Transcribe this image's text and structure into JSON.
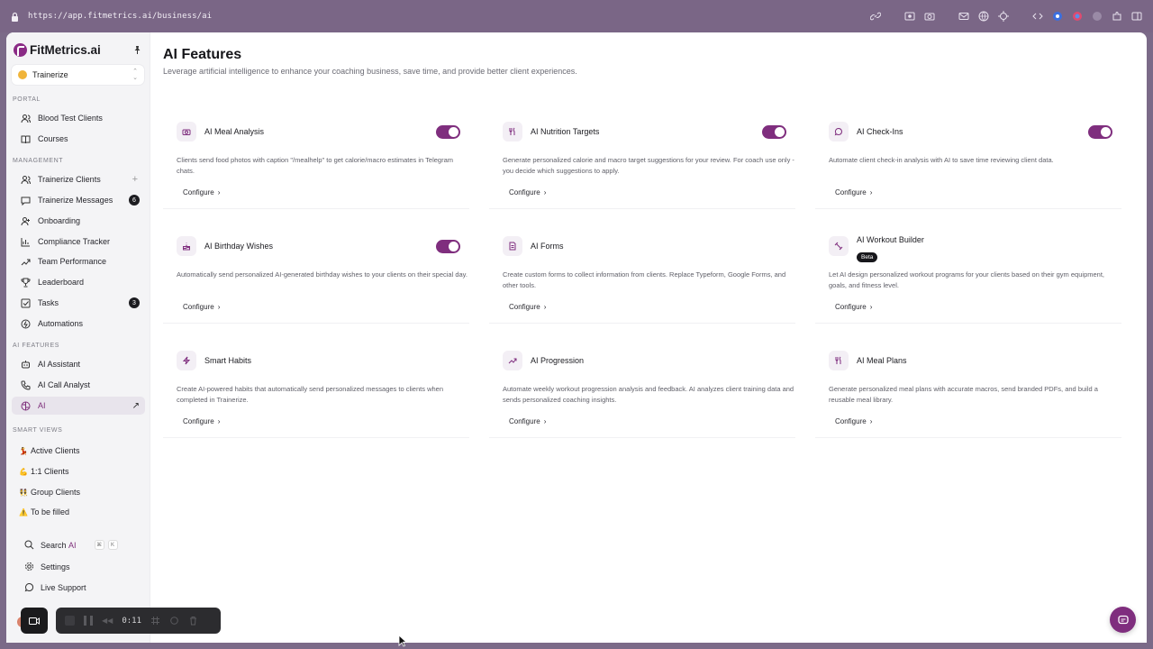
{
  "browser": {
    "url": "https://app.fitmetrics.ai/business/ai"
  },
  "brand": {
    "name": "FitMetrics.ai",
    "accent": "#7f2e7e"
  },
  "workspace": {
    "name": "Trainerize"
  },
  "sidebar": {
    "portal_label": "PORTAL",
    "portal_items": [
      {
        "label": "Blood Test Clients",
        "icon": "users-icon"
      },
      {
        "label": "Courses",
        "icon": "book-icon"
      }
    ],
    "management_label": "MANAGEMENT",
    "management_items": [
      {
        "label": "Trainerize Clients",
        "icon": "users-icon"
      },
      {
        "label": "Trainerize Messages",
        "icon": "message-icon",
        "badge": "6"
      },
      {
        "label": "Onboarding",
        "icon": "user-plus-icon"
      },
      {
        "label": "Compliance Tracker",
        "icon": "chart-icon"
      },
      {
        "label": "Team Performance",
        "icon": "trend-icon"
      },
      {
        "label": "Leaderboard",
        "icon": "trophy-icon"
      },
      {
        "label": "Tasks",
        "icon": "checkbox-icon",
        "badge": "3"
      },
      {
        "label": "Automations",
        "icon": "bolt-icon"
      }
    ],
    "ai_label": "AI FEATURES",
    "ai_items": [
      {
        "label": "AI Assistant",
        "icon": "robot-icon"
      },
      {
        "label": "AI Call Analyst",
        "icon": "phone-icon"
      },
      {
        "label": "AI",
        "icon": "brain-icon"
      }
    ],
    "smart_views_label": "SMART VIEWS",
    "smart_views": [
      {
        "emoji": "💃",
        "label": "Active Clients"
      },
      {
        "emoji": "💪",
        "label": "1:1 Clients"
      },
      {
        "emoji": "👯",
        "label": "Group Clients"
      },
      {
        "emoji": "⚠️",
        "label": "To be filled"
      }
    ],
    "bottom": {
      "search": "Search",
      "search_accent": "AI",
      "kbd1": "⌘",
      "kbd2": "K",
      "settings": "Settings",
      "support": "Live Support"
    }
  },
  "main": {
    "title": "AI Features",
    "subtitle": "Leverage artificial intelligence to enhance your coaching business, save time, and provide better client experiences.",
    "configure_label": "Configure",
    "beta_label": "Beta",
    "cards": [
      {
        "title": "AI Meal Analysis",
        "icon": "camera-icon",
        "enabled": true,
        "desc": "Clients send food photos with caption \"/mealhelp\" to get calorie/macro estimates in Telegram chats."
      },
      {
        "title": "AI Nutrition Targets",
        "icon": "utensils-icon",
        "enabled": true,
        "desc": "Generate personalized calorie and macro target suggestions for your review. For coach use only - you decide which suggestions to apply."
      },
      {
        "title": "AI Check-Ins",
        "icon": "chat-icon",
        "enabled": true,
        "desc": "Automate client check-in analysis with AI to save time reviewing client data."
      },
      {
        "title": "AI Birthday Wishes",
        "icon": "cake-icon",
        "enabled": true,
        "desc": "Automatically send personalized AI-generated birthday wishes to your clients on their special day."
      },
      {
        "title": "AI Forms",
        "icon": "form-icon",
        "enabled": false,
        "desc": "Create custom forms to collect information from clients. Replace Typeform, Google Forms, and other tools."
      },
      {
        "title": "AI Workout Builder",
        "icon": "dumbbell-icon",
        "enabled": false,
        "beta": true,
        "desc": "Let AI design personalized workout programs for your clients based on their gym equipment, goals, and fitness level."
      },
      {
        "title": "Smart Habits",
        "icon": "zap-icon",
        "enabled": false,
        "desc": "Create AI-powered habits that automatically send personalized messages to clients when completed in Trainerize."
      },
      {
        "title": "AI Progression",
        "icon": "trend-up-icon",
        "enabled": false,
        "desc": "Automate weekly workout progression analysis and feedback. AI analyzes client training data and sends personalized coaching insights."
      },
      {
        "title": "AI Meal Plans",
        "icon": "utensils-icon",
        "enabled": false,
        "desc": "Generate personalized meal plans with accurate macros, send branded PDFs, and build a reusable meal library."
      }
    ]
  },
  "recorder": {
    "time": "0:11"
  }
}
